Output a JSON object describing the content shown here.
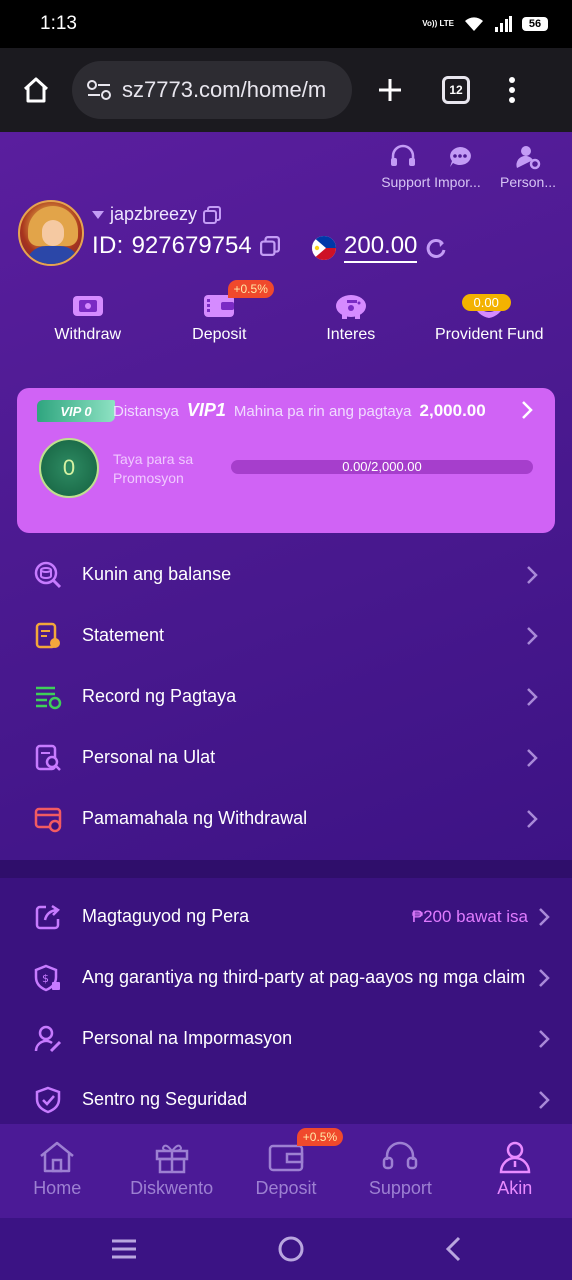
{
  "status_bar": {
    "time": "1:13",
    "volte": "Vo)) LTE",
    "battery": "56"
  },
  "browser": {
    "url": "sz7773.com/home/m",
    "tab_count": "12"
  },
  "top_links": [
    {
      "label": "Support Impor...",
      "icon": "headset-icon"
    },
    {
      "label": "Person...",
      "icon": "user-gear-icon"
    }
  ],
  "top_links_message_icon": "chat-icon",
  "profile": {
    "username": "japzbreezy",
    "id_label": "ID:",
    "id_value": "927679754",
    "balance": "200.00"
  },
  "quick_actions": [
    {
      "label": "Withdraw",
      "icon": "withdraw-icon"
    },
    {
      "label": "Deposit",
      "icon": "wallet-icon",
      "badge": "+0.5%"
    },
    {
      "label": "Interes",
      "icon": "piggy-bank-icon"
    },
    {
      "label": "Provident Fund",
      "icon": "hands-coin-icon",
      "badge": "0.00"
    }
  ],
  "vip": {
    "tag": "VIP 0",
    "prefix": "Distansya",
    "next_level": "VIP1",
    "text": "Mahina pa rin ang pagtaya",
    "amount": "2,000.00",
    "medal_level": "0",
    "promo_label": "Taya para sa Promosyon",
    "progress_text": "0.00/2,000.00",
    "progress_fraction": 0
  },
  "menu_group_1": [
    {
      "label": "Kunin ang balanse",
      "icon": "coins-search-icon",
      "color": "#c77bff"
    },
    {
      "label": "Statement",
      "icon": "statement-icon",
      "color": "#f3a73b"
    },
    {
      "label": "Record ng Pagtaya",
      "icon": "record-list-icon",
      "color": "#3fcf59"
    },
    {
      "label": "Personal na Ulat",
      "icon": "report-search-icon",
      "color": "#c77bff"
    },
    {
      "label": "Pamamahala ng Withdrawal",
      "icon": "card-gear-icon",
      "color": "#f25b62"
    }
  ],
  "menu_group_2": [
    {
      "label": "Magtaguyod ng Pera",
      "icon": "share-icon",
      "extra": "₱200 bawat isa"
    },
    {
      "label": "Ang garantiya ng third-party at pag-aayos ng mga claim",
      "icon": "shield-dollar-icon"
    },
    {
      "label": "Personal na Impormasyon",
      "icon": "user-edit-icon"
    },
    {
      "label": "Sentro ng Seguridad",
      "icon": "shield-check-icon"
    }
  ],
  "bottom_nav": [
    {
      "label": "Home",
      "icon": "home-icon"
    },
    {
      "label": "Diskwento",
      "icon": "gift-icon"
    },
    {
      "label": "Deposit",
      "icon": "wallet-icon",
      "badge": "+0.5%"
    },
    {
      "label": "Support",
      "icon": "headset-icon"
    },
    {
      "label": "Akin",
      "icon": "user-icon",
      "active": true
    }
  ],
  "colors": {
    "accent": "#e98bff",
    "card": "#d063f5",
    "background": "#3a127f"
  }
}
